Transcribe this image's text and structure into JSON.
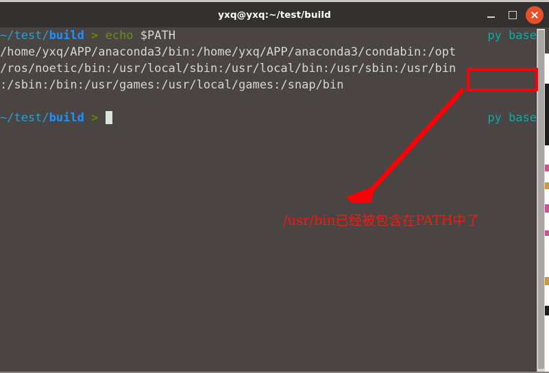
{
  "window": {
    "title": "yxq@yxq:~/test/build",
    "controls": {
      "minimize_label": "Minimize",
      "maximize_label": "Maximize",
      "close_label": "Close"
    }
  },
  "theme": {
    "titlebar_bg": "#333130",
    "terminal_bg": "#4a4542",
    "foreground": "#d5d8d6",
    "prompt_path": "#2a9fd6",
    "prompt_dir": "#1e90ff",
    "prompt_arrow": "#5f8700",
    "command": "#6a8c1c",
    "venv": "#11a8a8",
    "annotation_red": "#fb0007",
    "close_button": "#e8502a"
  },
  "terminal": {
    "lines": [
      {
        "type": "prompt",
        "path_prefix": "~/test/",
        "path_dir": "build",
        "arrow": ">",
        "command": "echo",
        "args": "$PATH",
        "right_status": "py base"
      },
      {
        "type": "output",
        "text": "/home/yxq/APP/anaconda3/bin:/home/yxq/APP/anaconda3/condabin:/opt"
      },
      {
        "type": "output",
        "text": "/ros/noetic/bin:/usr/local/sbin:/usr/local/bin:/usr/sbin:/usr/bin"
      },
      {
        "type": "output",
        "text": ":/sbin:/bin:/usr/games:/usr/local/games:/snap/bin"
      },
      {
        "type": "blank",
        "text": ""
      },
      {
        "type": "prompt",
        "path_prefix": "~/test/",
        "path_dir": "build",
        "arrow": ">",
        "command": "",
        "args": "",
        "right_status": "py base"
      }
    ]
  },
  "annotations": {
    "highlight_box_target": "/usr/bin",
    "note_text": "/usr/bin已经被包含在PATH中了",
    "arrow_label": "red-arrow-pointing-to-note"
  }
}
